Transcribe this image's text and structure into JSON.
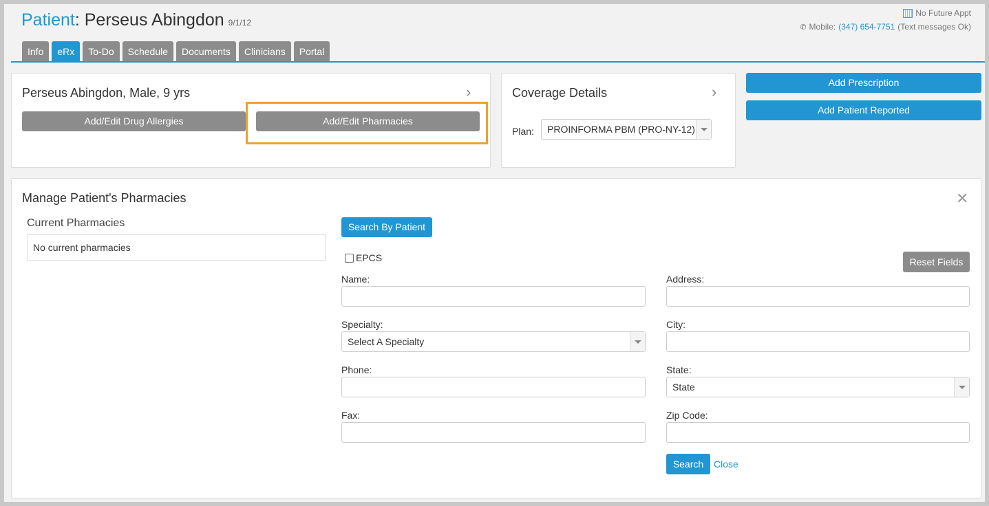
{
  "header": {
    "patient_label": "Patient",
    "patient_name": ": Perseus Abingdon",
    "dob": "9/1/12",
    "appt": "No Future Appt",
    "mobile_label": "Mobile:",
    "mobile_number": "(347) 654-7751",
    "mobile_note": "(Text messages Ok)"
  },
  "tabs": [
    {
      "label": "Info"
    },
    {
      "label": "eRx",
      "active": true
    },
    {
      "label": "To-Do"
    },
    {
      "label": "Schedule"
    },
    {
      "label": "Documents"
    },
    {
      "label": "Clinicians"
    },
    {
      "label": "Portal"
    }
  ],
  "patient_panel": {
    "summary": "Perseus Abingdon, Male, 9 yrs",
    "allergies_button": "Add/Edit Drug Allergies",
    "pharmacies_button": "Add/Edit Pharmacies"
  },
  "coverage_panel": {
    "title": "Coverage Details",
    "plan_label": "Plan:",
    "plan_value": "PROINFORMA PBM (PRO-NY-12)"
  },
  "actions": {
    "add_prescription": "Add Prescription",
    "add_patient_reported": "Add Patient Reported"
  },
  "pharmacies": {
    "title": "Manage Patient's Pharmacies",
    "current_title": "Current Pharmacies",
    "current_empty": "No current pharmacies",
    "search_by_patient": "Search By Patient",
    "epcs_label": "EPCS",
    "reset_fields": "Reset Fields",
    "name_label": "Name:",
    "specialty_label": "Specialty:",
    "specialty_value": "Select A Specialty",
    "phone_label": "Phone:",
    "fax_label": "Fax:",
    "address_label": "Address:",
    "city_label": "City:",
    "state_label": "State:",
    "state_value": "State",
    "zip_label": "Zip Code:",
    "search_button": "Search",
    "close_link": "Close"
  },
  "colors": {
    "accent": "#2196d3",
    "button_gray": "#8c8c8c",
    "highlight": "#f0a030"
  }
}
